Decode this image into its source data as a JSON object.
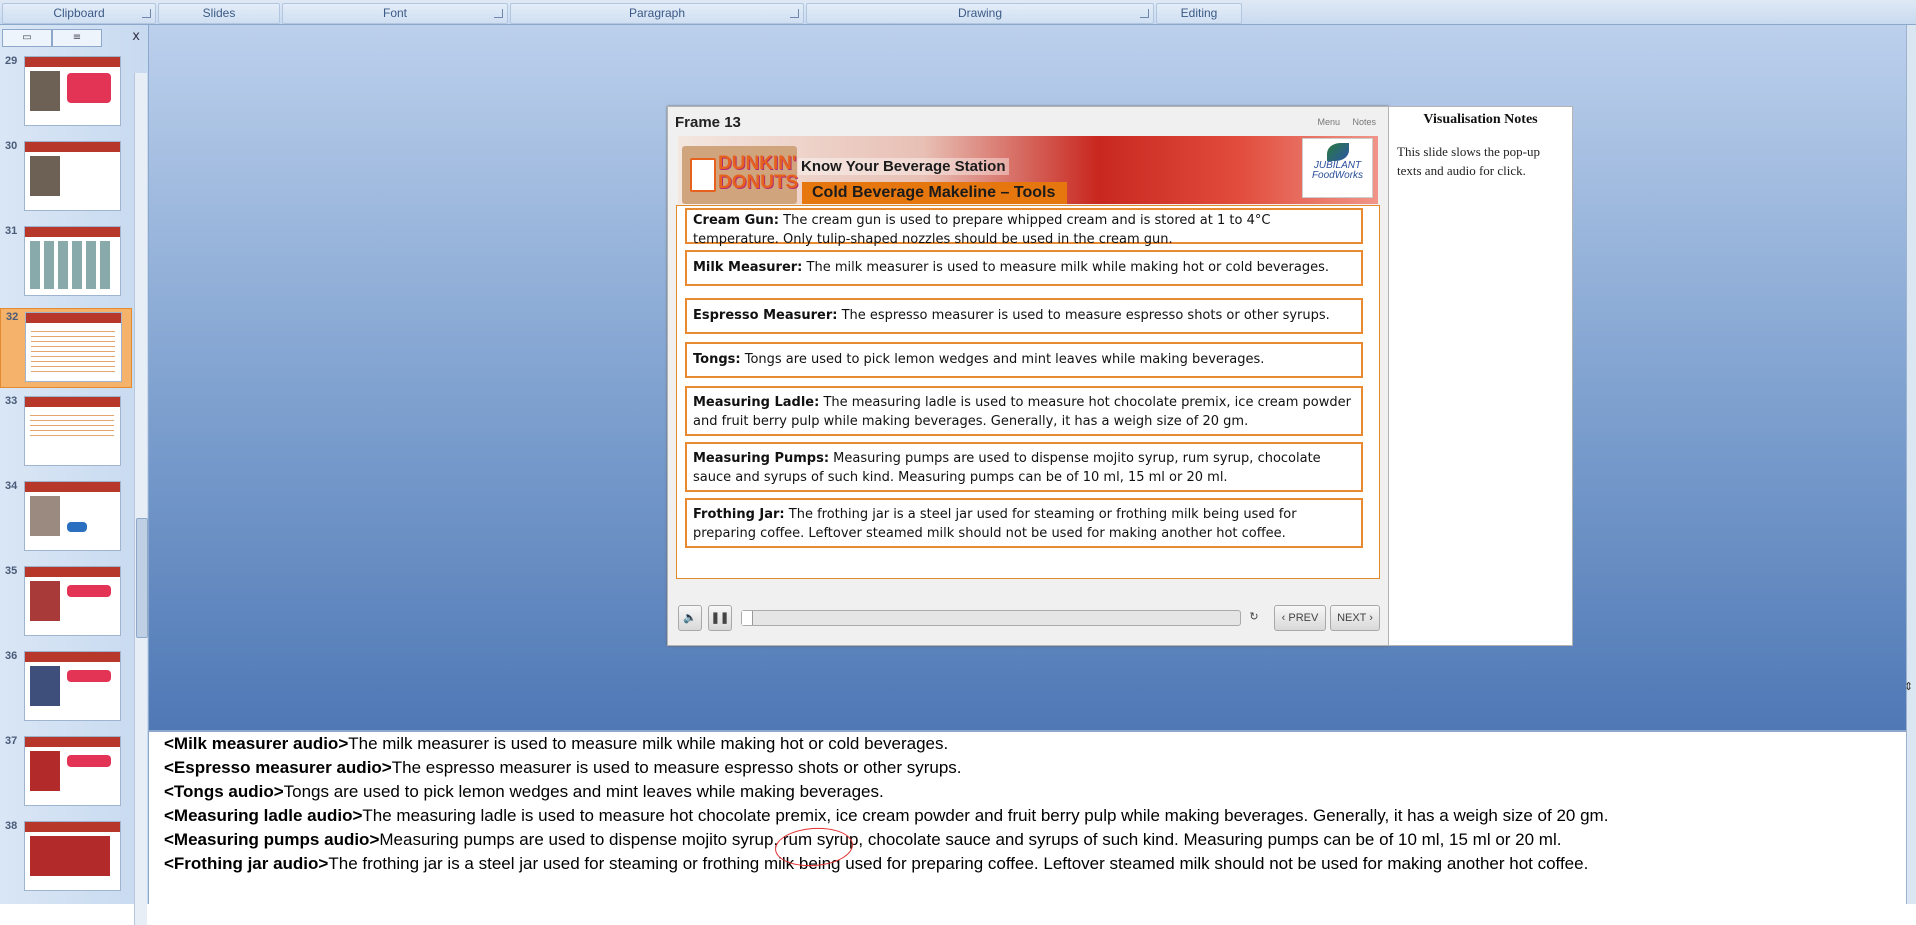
{
  "ribbon": {
    "groups": [
      "Clipboard",
      "Slides",
      "Font",
      "Paragraph",
      "Drawing",
      "Editing"
    ]
  },
  "panel": {
    "close_label": "x",
    "thumbnails": [
      "29",
      "30",
      "31",
      "32",
      "33",
      "34",
      "35",
      "36",
      "37",
      "38"
    ],
    "selected": "32"
  },
  "frame": {
    "title": "Frame 13",
    "menu_label": "Menu",
    "notes_label": "Notes",
    "brand": "DUNKIN' DONUTS",
    "banner_sub": "Know Your Beverage Station",
    "banner_head": "Cold Beverage Makeline – Tools",
    "partner": "JUBILANT FoodWorks",
    "items": [
      {
        "term": "Cream Gun:",
        "text": " The cream gun is used to prepare whipped cream and is stored at 1 to 4°C temperature. Only tulip-shaped nozzles should be used in the cream gun."
      },
      {
        "term": "Milk Measurer:",
        "text": " The milk measurer is used to measure milk while making hot or cold beverages."
      },
      {
        "term": "Espresso Measurer:",
        "text": " The espresso measurer is used to measure espresso shots or other syrups."
      },
      {
        "term": "Tongs:",
        "text": " Tongs are used to pick lemon wedges and mint leaves while making beverages."
      },
      {
        "term": "Measuring Ladle:",
        "text": " The measuring ladle is used to measure hot chocolate premix, ice cream powder and fruit berry pulp while making beverages. Generally, it has a weigh size of 20 gm."
      },
      {
        "term": "Measuring Pumps:",
        "text": " Measuring pumps are used to dispense mojito syrup, rum syrup, chocolate sauce and syrups of such kind. Measuring pumps can be of 10 ml, 15 ml or 20 ml."
      },
      {
        "term": "Frothing Jar:",
        "text": " The frothing jar is a steel jar used for steaming or frothing milk being used for preparing coffee. Leftover steamed milk should not be used for making another hot coffee."
      }
    ],
    "controls": {
      "prev_label": "‹ PREV",
      "next_label": "NEXT ›",
      "progress": 0.02
    }
  },
  "vis_notes": {
    "title": "Visualisation Notes",
    "body": "This slide slows the pop-up texts and audio for click."
  },
  "notes_pane": {
    "lines": [
      {
        "tag": "<Milk measurer audio>",
        "text": "The milk measurer is used to measure milk while making hot or cold beverages."
      },
      {
        "tag": "<Espresso measurer audio>",
        "text": "The espresso measurer is used to measure espresso shots or other syrups."
      },
      {
        "tag": "<Tongs audio>",
        "text": "Tongs are used to pick lemon wedges and mint leaves while making beverages."
      },
      {
        "tag": "<Measuring ladle audio>",
        "text": "The measuring ladle is used to measure hot chocolate premix, ice cream powder and fruit berry pulp while making beverages. Generally, it has a weigh size of 20 gm."
      },
      {
        "tag": "<Measuring pumps audio>",
        "text": "Measuring pumps are used to dispense mojito syrup, rum syrup, chocolate sauce and syrups of such kind. Measuring pumps can be of 10 ml, 15 ml or 20 ml."
      },
      {
        "tag": "<Frothing jar audio>",
        "text": "The frothing jar is a steel jar used for steaming or frothing milk being used for preparing coffee. Leftover steamed milk should not be used for making another hot coffee."
      }
    ]
  },
  "colors": {
    "accent_orange": "#e88a31",
    "banner_red": "#c8271f",
    "stage_blue": "#4f78b5"
  }
}
